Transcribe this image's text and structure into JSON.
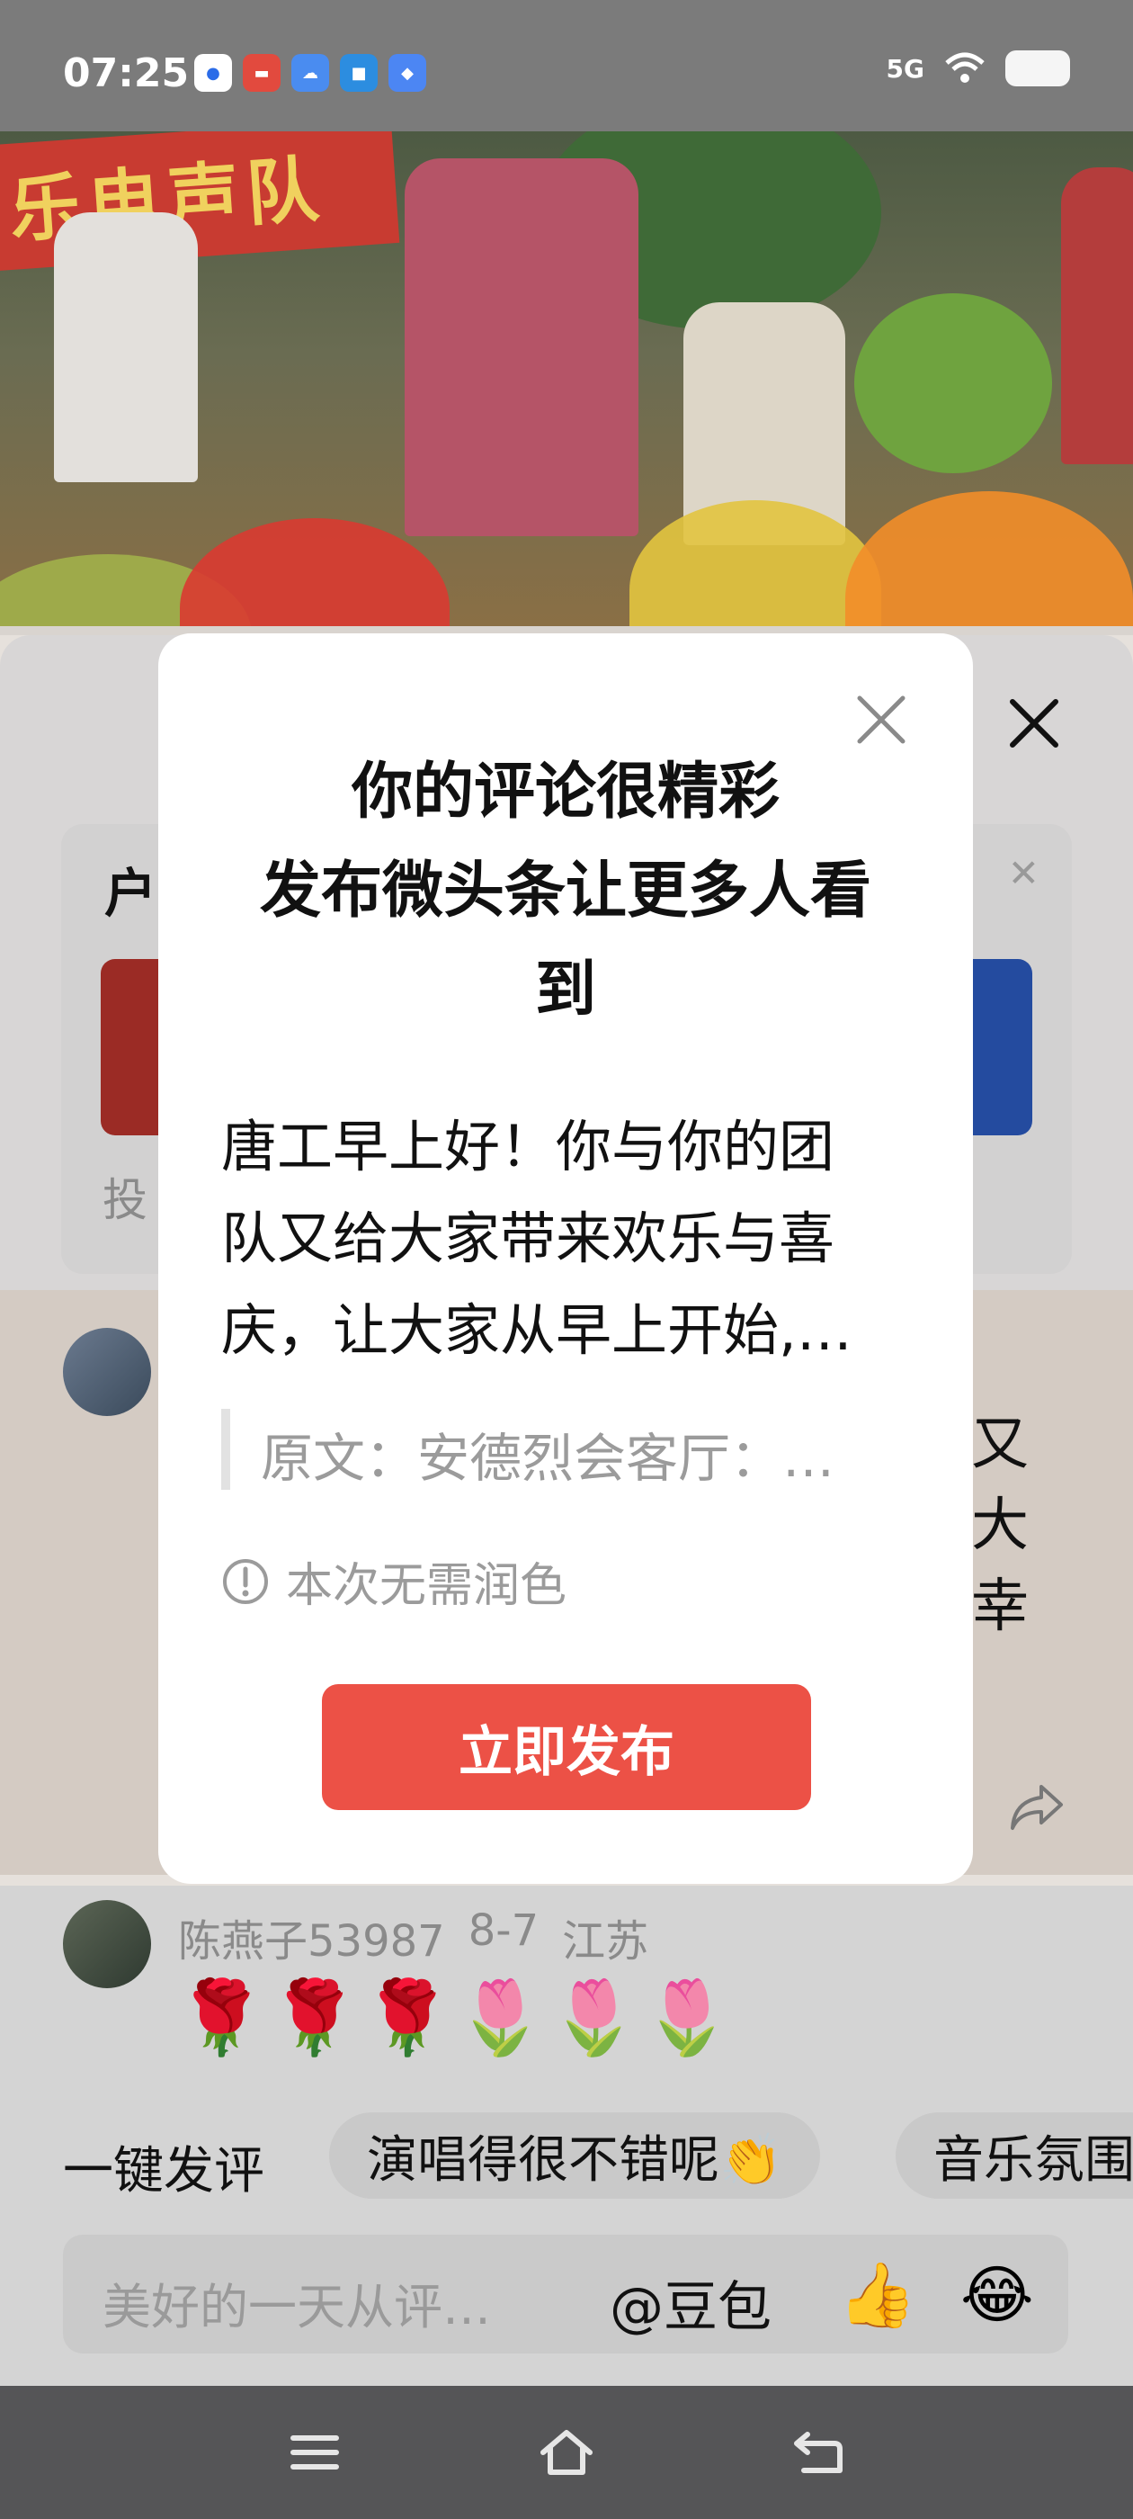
{
  "status_bar": {
    "time": "07:25",
    "app_icons": [
      "baidu-icon",
      "toutiao-icon",
      "cloud-icon",
      "map-icon",
      "shield-icon"
    ],
    "signal_label": "5G"
  },
  "video": {
    "banner_text": "乐电声队"
  },
  "task_card": {
    "title_partial": "户",
    "subtitle_partial": "投"
  },
  "comment": {
    "right_lines": [
      "又",
      "大",
      "幸"
    ]
  },
  "second_comment": {
    "username": "陈燕子53987",
    "date": "8-7",
    "location": "江苏",
    "emojis": "🌹🌹🌹🌷🌷🌷"
  },
  "quick_reply": {
    "label": "一键发评",
    "chips": [
      "演唱得很不错呢👏",
      "音乐氛围"
    ]
  },
  "input_bar": {
    "placeholder": "美好的一天从评…",
    "mention": "@豆包",
    "emoji_thumb": "👍",
    "emoji_laugh": "😂"
  },
  "modal": {
    "title_line1": "你的评论很精彩",
    "title_line2": "发布微头条让更多人看",
    "title_line3": "到",
    "body_line1": "唐工早上好！你与你的团",
    "body_line2": "队又给大家带来欢乐与喜",
    "body_line3": "庆，让大家从早上开始,…",
    "quote": "原文：安德烈会客厅：…",
    "notice": "本次无需润色",
    "publish_button": "立即发布"
  },
  "colors": {
    "accent": "#ec5146",
    "overlay": "#d4d4d4",
    "nav_bar": "#555557"
  }
}
